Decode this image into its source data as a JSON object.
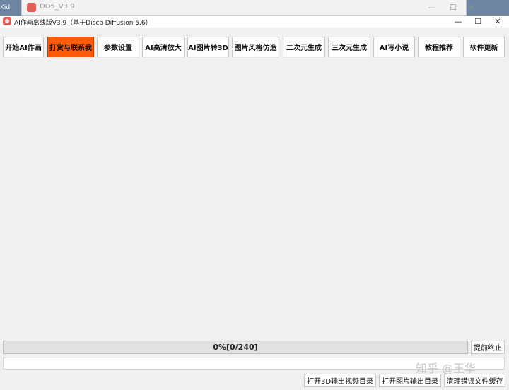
{
  "desktop": {
    "label": "Kid"
  },
  "background_window": {
    "title": "DD5_V3.9",
    "controls": {
      "minimize": "—",
      "maximize": "☐",
      "close": "✕"
    }
  },
  "window": {
    "title": "AI作画离线版V3.9（基于Disco Diffusion 5.6）",
    "controls": {
      "minimize": "—",
      "maximize": "☐",
      "close": "✕"
    }
  },
  "toolbar": {
    "buttons": [
      "开始AI作画",
      "打赏与联系我",
      "参数设置",
      "AI高清放大",
      "AI图片转3D",
      "图片风格仿造",
      "二次元生成",
      "三次元生成",
      "AI写小说",
      "教程推荐",
      "软件更新"
    ],
    "active_index": 1
  },
  "progress": {
    "text": "0%[0/240]",
    "fraction": 0.0
  },
  "actions": {
    "stop_early": "提前终止",
    "open_3d_dir": "打开3D输出视频目录",
    "open_image_dir": "打开图片输出目录",
    "clear_error_cache": "清理错误文件缓存"
  },
  "watermark": "知乎 @王华",
  "colors": {
    "active_button": "#ff5a0a",
    "window_bg": "#f0f0f0"
  }
}
